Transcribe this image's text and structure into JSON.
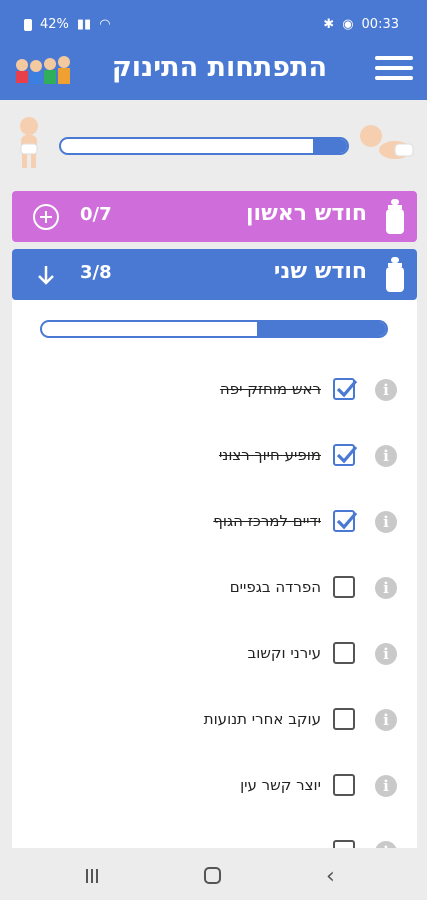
{
  "status_bar": {
    "battery": "42%",
    "time": "00:33"
  },
  "app_bar": {
    "title": "התפתחות התינוק"
  },
  "overall_progress": 0.12,
  "months": [
    {
      "title": "חודש ראשון",
      "count": "0/7",
      "expanded": false,
      "color": "#cf6ddb"
    },
    {
      "title": "חודש שני",
      "count": "3/8",
      "expanded": true,
      "color": "#4a79d4"
    }
  ],
  "month_progress": 0.375,
  "milestones": [
    {
      "label": "ראש מוחזק יפה",
      "checked": true
    },
    {
      "label": "מופיע חיוך רצוני",
      "checked": true
    },
    {
      "label": "ידיים למרכז הגוף",
      "checked": true
    },
    {
      "label": "הפרדה בגפיים",
      "checked": false
    },
    {
      "label": "עירני וקשוב",
      "checked": false
    },
    {
      "label": "עוקב אחרי תנועות",
      "checked": false
    },
    {
      "label": "יוצר קשר עין",
      "checked": false
    }
  ],
  "colors": {
    "primary": "#4a79d4",
    "month1": "#cf6ddb"
  }
}
